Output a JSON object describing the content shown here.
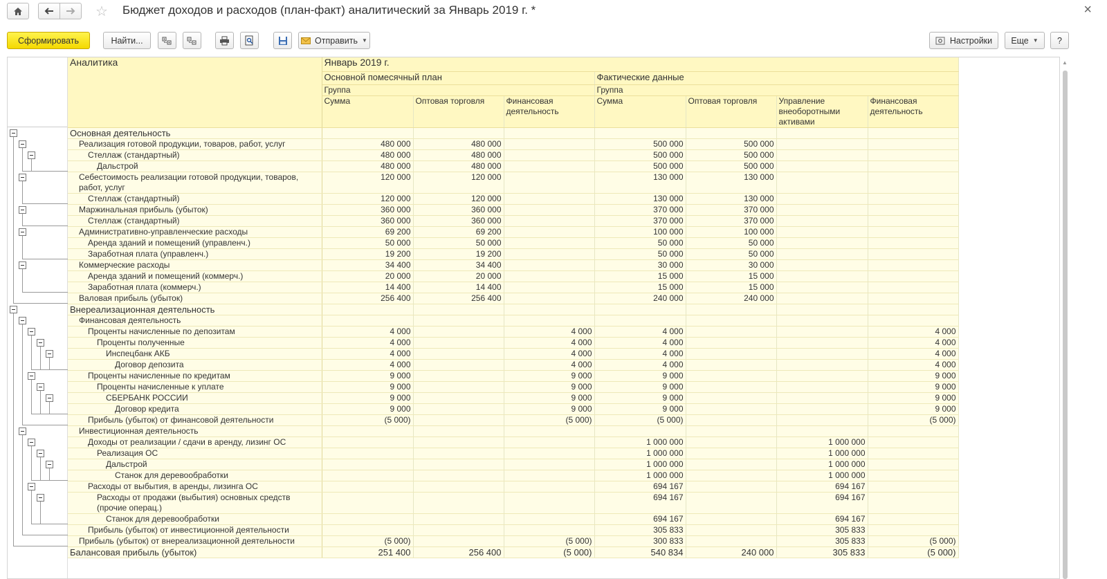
{
  "window": {
    "title": "Бюджет доходов и расходов (план-факт) аналитический  за Январь 2019 г. *",
    "close": "×"
  },
  "nav": {
    "home_icon": "home-icon",
    "back_icon": "arrow-left-icon",
    "forward_icon": "arrow-right-icon",
    "star_icon": "star-icon"
  },
  "toolbar": {
    "generate": "Сформировать",
    "find": "Найти...",
    "send": "Отправить",
    "settings": "Настройки",
    "more": "Еще",
    "help": "?"
  },
  "header": {
    "analytics": "Аналитика",
    "period": "Январь 2019 г.",
    "plan": "Основной помесячный план",
    "fact": "Фактические данные",
    "group": "Группа",
    "cols": [
      "Сумма",
      "Оптовая торговля",
      "Финансовая деятельность",
      "Сумма",
      "Оптовая торговля",
      "Управление внеоборотными активами",
      "Финансовая деятельность"
    ]
  },
  "rows": [
    {
      "label": "Основная деятельность",
      "indent": 0,
      "v": [
        "",
        "",
        "",
        "",
        "",
        "",
        ""
      ]
    },
    {
      "label": "Реализация готовой продукции, товаров, работ, услуг",
      "indent": 1,
      "v": [
        "480 000",
        "480 000",
        "",
        "500 000",
        "500 000",
        "",
        ""
      ]
    },
    {
      "label": "Стеллаж (стандартный)",
      "indent": 2,
      "v": [
        "480 000",
        "480 000",
        "",
        "500 000",
        "500 000",
        "",
        ""
      ]
    },
    {
      "label": "Дальстрой",
      "indent": 3,
      "v": [
        "480 000",
        "480 000",
        "",
        "500 000",
        "500 000",
        "",
        ""
      ]
    },
    {
      "label": "Себестоимость реализации готовой продукции, товаров, работ, услуг",
      "indent": 1,
      "wrap": true,
      "v": [
        "120 000",
        "120 000",
        "",
        "130 000",
        "130 000",
        "",
        ""
      ]
    },
    {
      "label": "Стеллаж (стандартный)",
      "indent": 2,
      "v": [
        "120 000",
        "120 000",
        "",
        "130 000",
        "130 000",
        "",
        ""
      ]
    },
    {
      "label": "Маржинальная прибыль (убыток)",
      "indent": 1,
      "v": [
        "360 000",
        "360 000",
        "",
        "370 000",
        "370 000",
        "",
        ""
      ]
    },
    {
      "label": "Стеллаж (стандартный)",
      "indent": 2,
      "v": [
        "360 000",
        "360 000",
        "",
        "370 000",
        "370 000",
        "",
        ""
      ]
    },
    {
      "label": "Административно-управленческие расходы",
      "indent": 1,
      "v": [
        "69 200",
        "69 200",
        "",
        "100 000",
        "100 000",
        "",
        ""
      ]
    },
    {
      "label": "Аренда зданий и помещений (управленч.)",
      "indent": 2,
      "v": [
        "50 000",
        "50 000",
        "",
        "50 000",
        "50 000",
        "",
        ""
      ]
    },
    {
      "label": "Заработная плата (управленч.)",
      "indent": 2,
      "v": [
        "19 200",
        "19 200",
        "",
        "50 000",
        "50 000",
        "",
        ""
      ]
    },
    {
      "label": "Коммерческие расходы",
      "indent": 1,
      "v": [
        "34 400",
        "34 400",
        "",
        "30 000",
        "30 000",
        "",
        ""
      ]
    },
    {
      "label": "Аренда зданий и помещений (коммерч.)",
      "indent": 2,
      "v": [
        "20 000",
        "20 000",
        "",
        "15 000",
        "15 000",
        "",
        ""
      ]
    },
    {
      "label": "Заработная плата (коммерч.)",
      "indent": 2,
      "v": [
        "14 400",
        "14 400",
        "",
        "15 000",
        "15 000",
        "",
        ""
      ]
    },
    {
      "label": "Валовая прибыль (убыток)",
      "indent": 1,
      "v": [
        "256 400",
        "256 400",
        "",
        "240 000",
        "240 000",
        "",
        ""
      ]
    },
    {
      "label": "Внереализационная деятельность",
      "indent": 0,
      "v": [
        "",
        "",
        "",
        "",
        "",
        "",
        ""
      ]
    },
    {
      "label": "Финансовая деятельность",
      "indent": 1,
      "v": [
        "",
        "",
        "",
        "",
        "",
        "",
        ""
      ]
    },
    {
      "label": "Проценты начисленные по депозитам",
      "indent": 2,
      "v": [
        "4 000",
        "",
        "4 000",
        "4 000",
        "",
        "",
        "4 000"
      ]
    },
    {
      "label": "Проценты полученные",
      "indent": 3,
      "v": [
        "4 000",
        "",
        "4 000",
        "4 000",
        "",
        "",
        "4 000"
      ]
    },
    {
      "label": "Инспецбанк АКБ",
      "indent": 4,
      "v": [
        "4 000",
        "",
        "4 000",
        "4 000",
        "",
        "",
        "4 000"
      ]
    },
    {
      "label": "Договор депозита",
      "indent": 5,
      "v": [
        "4 000",
        "",
        "4 000",
        "4 000",
        "",
        "",
        "4 000"
      ]
    },
    {
      "label": "Проценты начисленные по кредитам",
      "indent": 2,
      "v": [
        "9 000",
        "",
        "9 000",
        "9 000",
        "",
        "",
        "9 000"
      ]
    },
    {
      "label": "Проценты начисленные к уплате",
      "indent": 3,
      "v": [
        "9 000",
        "",
        "9 000",
        "9 000",
        "",
        "",
        "9 000"
      ]
    },
    {
      "label": "СБЕРБАНК РОССИИ",
      "indent": 4,
      "v": [
        "9 000",
        "",
        "9 000",
        "9 000",
        "",
        "",
        "9 000"
      ]
    },
    {
      "label": "Договор кредита",
      "indent": 5,
      "v": [
        "9 000",
        "",
        "9 000",
        "9 000",
        "",
        "",
        "9 000"
      ]
    },
    {
      "label": "Прибыль (убыток) от финансовой деятельности",
      "indent": 2,
      "v": [
        "(5 000)",
        "",
        "(5 000)",
        "(5 000)",
        "",
        "",
        "(5 000)"
      ]
    },
    {
      "label": "Инвестиционная деятельность",
      "indent": 1,
      "v": [
        "",
        "",
        "",
        "",
        "",
        "",
        ""
      ]
    },
    {
      "label": "Доходы от реализации / сдачи в аренду, лизинг ОС",
      "indent": 2,
      "v": [
        "",
        "",
        "",
        "1 000 000",
        "",
        "1 000 000",
        ""
      ]
    },
    {
      "label": "Реализация ОС",
      "indent": 3,
      "v": [
        "",
        "",
        "",
        "1 000 000",
        "",
        "1 000 000",
        ""
      ]
    },
    {
      "label": "Дальстрой",
      "indent": 4,
      "v": [
        "",
        "",
        "",
        "1 000 000",
        "",
        "1 000 000",
        ""
      ]
    },
    {
      "label": "Станок для деревообработки",
      "indent": 5,
      "v": [
        "",
        "",
        "",
        "1 000 000",
        "",
        "1 000 000",
        ""
      ]
    },
    {
      "label": "Расходы от выбытия, в аренды, лизинга ОС",
      "indent": 2,
      "v": [
        "",
        "",
        "",
        "694 167",
        "",
        "694 167",
        ""
      ]
    },
    {
      "label": "Расходы от продажи (выбытия) основных средств (прочие операц.)",
      "indent": 3,
      "wrap": true,
      "v": [
        "",
        "",
        "",
        "694 167",
        "",
        "694 167",
        ""
      ]
    },
    {
      "label": "Станок для деревообработки",
      "indent": 4,
      "v": [
        "",
        "",
        "",
        "694 167",
        "",
        "694 167",
        ""
      ]
    },
    {
      "label": "Прибыль (убыток) от инвестиционной деятельности",
      "indent": 2,
      "v": [
        "",
        "",
        "",
        "305 833",
        "",
        "305 833",
        ""
      ]
    },
    {
      "label": "Прибыль (убыток) от внереализационной деятельности",
      "indent": 1,
      "v": [
        "(5 000)",
        "",
        "(5 000)",
        "300 833",
        "",
        "305 833",
        "(5 000)"
      ]
    },
    {
      "label": "Балансовая прибыль (убыток)",
      "indent": 0,
      "big": true,
      "v": [
        "251 400",
        "256 400",
        "(5 000)",
        "540 834",
        "240 000",
        "305 833",
        "(5 000)"
      ]
    }
  ]
}
